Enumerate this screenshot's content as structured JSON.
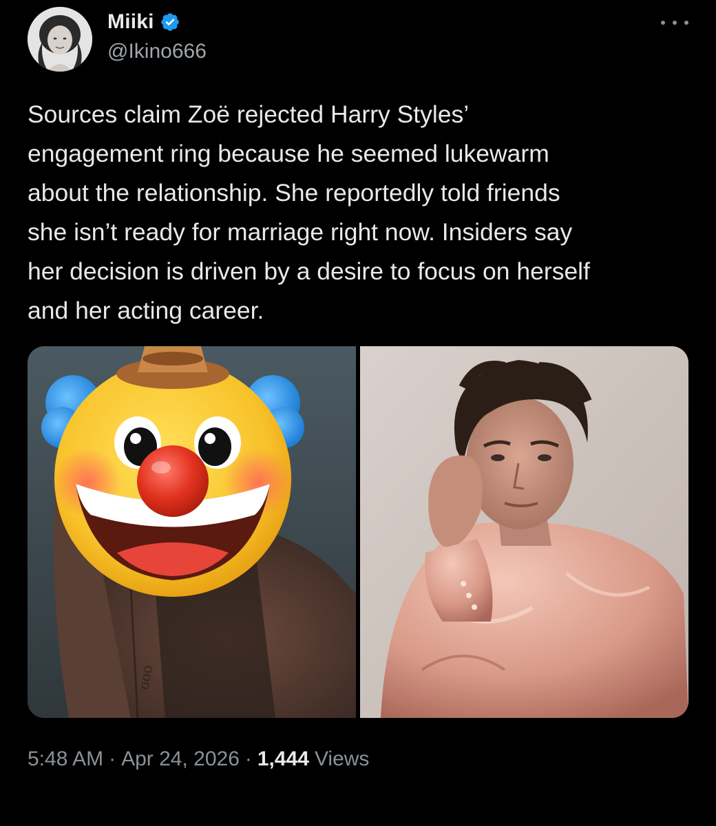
{
  "author": {
    "display_name": "Miiki",
    "handle": "@Ikino666",
    "verified": true
  },
  "icons": {
    "verified": "verified-badge-icon",
    "more": "more-options-icon",
    "overlay_emoji": "clown-face-emoji"
  },
  "tweet": {
    "text": "Sources claim Zoë rejected Harry Styles’\nengagement ring because he seemed lukewarm\nabout the relationship. She reportedly told friends\nshe isn’t ready for marriage right now. Insiders say\nher decision is driven by a desire to focus on herself\nand her acting career."
  },
  "meta": {
    "time": "5:48 AM",
    "separator": "·",
    "date": "Apr 24, 2026",
    "views_count": "1,444",
    "views_label": "Views"
  },
  "colors": {
    "background": "#000000",
    "text_primary": "#e7e9ea",
    "text_secondary": "#8b9196",
    "verified_blue": "#1d9bf0"
  }
}
